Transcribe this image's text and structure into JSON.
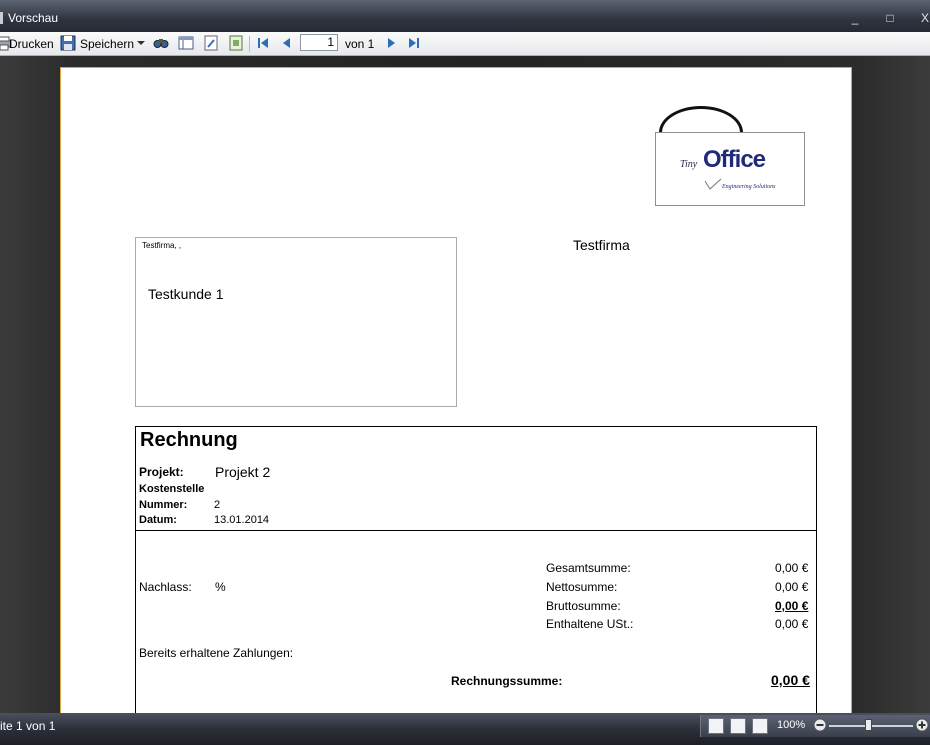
{
  "window": {
    "title": "Vorschau",
    "minimize": "_",
    "maximize": "□",
    "close": "X"
  },
  "toolbar": {
    "print_label": "Drucken",
    "save_label": "Speichern",
    "page_value": "1",
    "page_of": "von 1"
  },
  "document": {
    "logo": {
      "small": "Tiny",
      "big": "Office",
      "tagline": "Engineering Solutions"
    },
    "sender_line": "Testfirma, ,",
    "recipient": "Testkunde 1",
    "company": "Testfirma",
    "invoice": {
      "title": "Rechnung",
      "projekt_label": "Projekt:",
      "projekt_value": "Projekt 2",
      "kostenstelle_label": "Kostenstelle",
      "nummer_label": "Nummer:",
      "nummer_value": "2",
      "datum_label": "Datum:",
      "datum_value": "13.01.2014",
      "nachlass_label": "Nachlass:",
      "nachlass_value": "%",
      "totals": [
        {
          "label": "Gesamtsumme:",
          "value": "0,00 €"
        },
        {
          "label": "Nettosumme:",
          "value": "0,00 €"
        },
        {
          "label": "Bruttosumme:",
          "value": "0,00 €"
        },
        {
          "label": "Enthaltene USt.:",
          "value": "0,00 €"
        }
      ],
      "payments_label": "Bereits erhaltene Zahlungen:",
      "sum_label": "Rechnungssumme:",
      "sum_value": "0,00 €"
    }
  },
  "status": {
    "page_info": "ite 1 von 1",
    "zoom": "100%"
  }
}
